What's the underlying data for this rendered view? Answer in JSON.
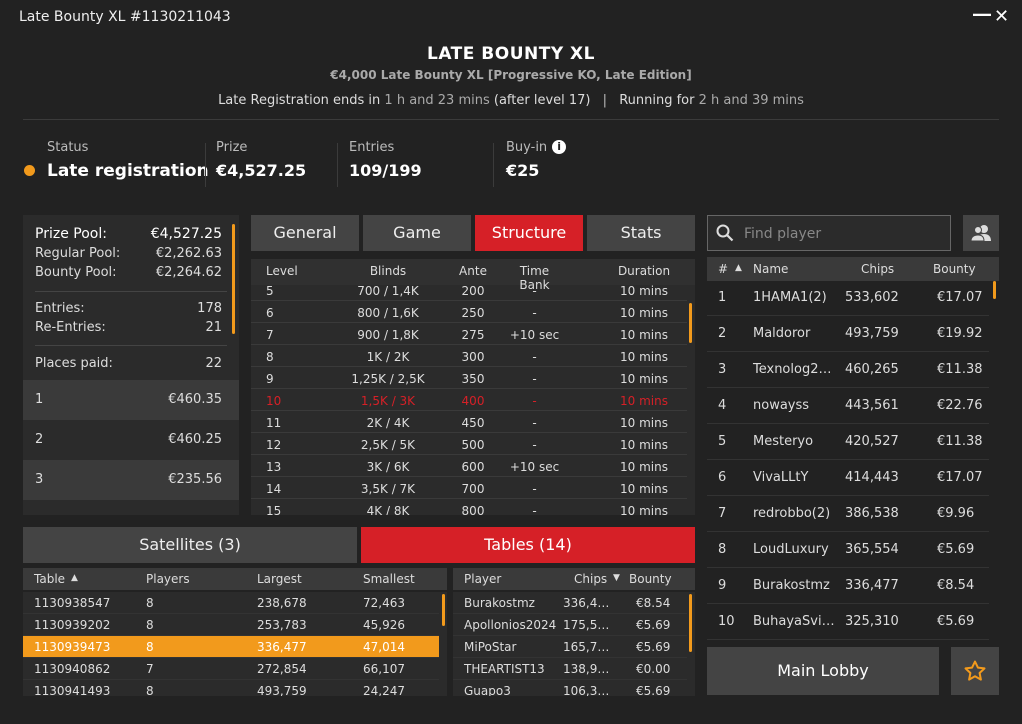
{
  "window": {
    "title": "Late Bounty XL #1130211043"
  },
  "header": {
    "title": "LATE BOUNTY XL",
    "subtitle": "€4,000 Late Bounty XL [Progressive KO, Late Edition]",
    "late_reg_prefix": "Late Registration ends in",
    "late_reg_value": "1 h and 23 mins",
    "late_reg_suffix": "(after level 17)",
    "separator": "|",
    "running_prefix": "Running for",
    "running_value": "2 h and 39 mins"
  },
  "stats": {
    "status_label": "Status",
    "status_value": "Late registration",
    "prize_label": "Prize",
    "prize_value": "€4,527.25",
    "entries_label": "Entries",
    "entries_value": "109/199",
    "buyin_label": "Buy-in",
    "buyin_value": "€25",
    "status_color": "#f29a1c"
  },
  "prize_pool": {
    "pool_label": "Prize Pool:",
    "pool_value": "€4,527.25",
    "regular_label": "Regular Pool:",
    "regular_value": "€2,262.63",
    "bounty_label": "Bounty Pool:",
    "bounty_value": "€2,264.62",
    "entries_label": "Entries:",
    "entries_value": "178",
    "reentries_label": "Re-Entries:",
    "reentries_value": "21",
    "places_label": "Places paid:",
    "places_value": "22",
    "places": [
      {
        "pos": "1",
        "amount": "€460.35"
      },
      {
        "pos": "2",
        "amount": "€460.25"
      },
      {
        "pos": "3",
        "amount": "€235.56"
      }
    ]
  },
  "tabs": [
    "General",
    "Game",
    "Structure",
    "Stats"
  ],
  "active_tab": "Structure",
  "structure": {
    "headers": [
      "Level",
      "Blinds",
      "Ante",
      "Time Bank",
      "Duration"
    ],
    "rows": [
      {
        "level": "5",
        "blinds": "700 / 1,4K",
        "ante": "200",
        "timebank": "-",
        "duration": "10 mins"
      },
      {
        "level": "6",
        "blinds": "800 / 1,6K",
        "ante": "250",
        "timebank": "-",
        "duration": "10 mins"
      },
      {
        "level": "7",
        "blinds": "900 / 1,8K",
        "ante": "275",
        "timebank": "+10 sec",
        "duration": "10 mins"
      },
      {
        "level": "8",
        "blinds": "1K / 2K",
        "ante": "300",
        "timebank": "-",
        "duration": "10 mins"
      },
      {
        "level": "9",
        "blinds": "1,25K / 2,5K",
        "ante": "350",
        "timebank": "-",
        "duration": "10 mins"
      },
      {
        "level": "10",
        "blinds": "1,5K / 3K",
        "ante": "400",
        "timebank": "-",
        "duration": "10 mins"
      },
      {
        "level": "11",
        "blinds": "2K / 4K",
        "ante": "450",
        "timebank": "-",
        "duration": "10 mins"
      },
      {
        "level": "12",
        "blinds": "2,5K / 5K",
        "ante": "500",
        "timebank": "-",
        "duration": "10 mins"
      },
      {
        "level": "13",
        "blinds": "3K / 6K",
        "ante": "600",
        "timebank": "+10 sec",
        "duration": "10 mins"
      },
      {
        "level": "14",
        "blinds": "3,5K / 7K",
        "ante": "700",
        "timebank": "-",
        "duration": "10 mins"
      },
      {
        "level": "15",
        "blinds": "4K / 8K",
        "ante": "800",
        "timebank": "-",
        "duration": "10 mins"
      }
    ],
    "current_level": "10",
    "current_color": "#d62027"
  },
  "players": {
    "search_placeholder": "Find player",
    "headers": {
      "num": "#",
      "name": "Name",
      "chips": "Chips",
      "bounty": "Bounty"
    },
    "rows": [
      {
        "n": "1",
        "name": "1HAMA1(2)",
        "chips": "533,602",
        "bounty": "€17.07"
      },
      {
        "n": "2",
        "name": "Maldoror",
        "chips": "493,759",
        "bounty": "€19.92"
      },
      {
        "n": "3",
        "name": "Texnolog2…",
        "chips": "460,265",
        "bounty": "€11.38"
      },
      {
        "n": "4",
        "name": "nowayss",
        "chips": "443,561",
        "bounty": "€22.76"
      },
      {
        "n": "5",
        "name": "Mesteryo",
        "chips": "420,527",
        "bounty": "€11.38"
      },
      {
        "n": "6",
        "name": "VivaLLtY",
        "chips": "414,443",
        "bounty": "€17.07"
      },
      {
        "n": "7",
        "name": "redrobbo(2)",
        "chips": "386,538",
        "bounty": "€9.96"
      },
      {
        "n": "8",
        "name": "LoudLuxury",
        "chips": "365,554",
        "bounty": "€5.69"
      },
      {
        "n": "9",
        "name": "Burakostmz",
        "chips": "336,477",
        "bounty": "€8.54"
      },
      {
        "n": "10",
        "name": "BuhayaSvi…",
        "chips": "325,310",
        "bounty": "€5.69"
      }
    ]
  },
  "bottom_tabs": {
    "satellites": "Satellites (3)",
    "tables": "Tables (14)"
  },
  "tables": {
    "headers": {
      "table": "Table",
      "players": "Players",
      "largest": "Largest",
      "smallest": "Smallest"
    },
    "rows": [
      {
        "table": "1130938547",
        "players": "8",
        "largest": "238,678",
        "smallest": "72,463"
      },
      {
        "table": "1130939202",
        "players": "8",
        "largest": "253,783",
        "smallest": "45,926"
      },
      {
        "table": "1130939473",
        "players": "8",
        "largest": "336,477",
        "smallest": "47,014"
      },
      {
        "table": "1130940862",
        "players": "7",
        "largest": "272,854",
        "smallest": "66,107"
      },
      {
        "table": "1130941493",
        "players": "8",
        "largest": "493,759",
        "smallest": "24,247"
      }
    ],
    "selected_table": "1130939473",
    "highlight_color": "#f29a1c"
  },
  "table_players": {
    "headers": {
      "player": "Player",
      "chips": "Chips",
      "bounty": "Bounty"
    },
    "rows": [
      {
        "player": "Burakostmz",
        "chips": "336,4…",
        "bounty": "€8.54"
      },
      {
        "player": "Apollonios2024",
        "chips": "175,5…",
        "bounty": "€5.69"
      },
      {
        "player": "MiPoStar",
        "chips": "165,7…",
        "bounty": "€5.69"
      },
      {
        "player": "THEARTIST13",
        "chips": "138,9…",
        "bounty": "€0.00"
      },
      {
        "player": "Guapo3",
        "chips": "106,3…",
        "bounty": "€5.69"
      }
    ]
  },
  "footer": {
    "main_lobby": "Main Lobby"
  },
  "colors": {
    "accent_red": "#d62027",
    "accent_orange": "#f29a1c",
    "background": "#222222"
  }
}
